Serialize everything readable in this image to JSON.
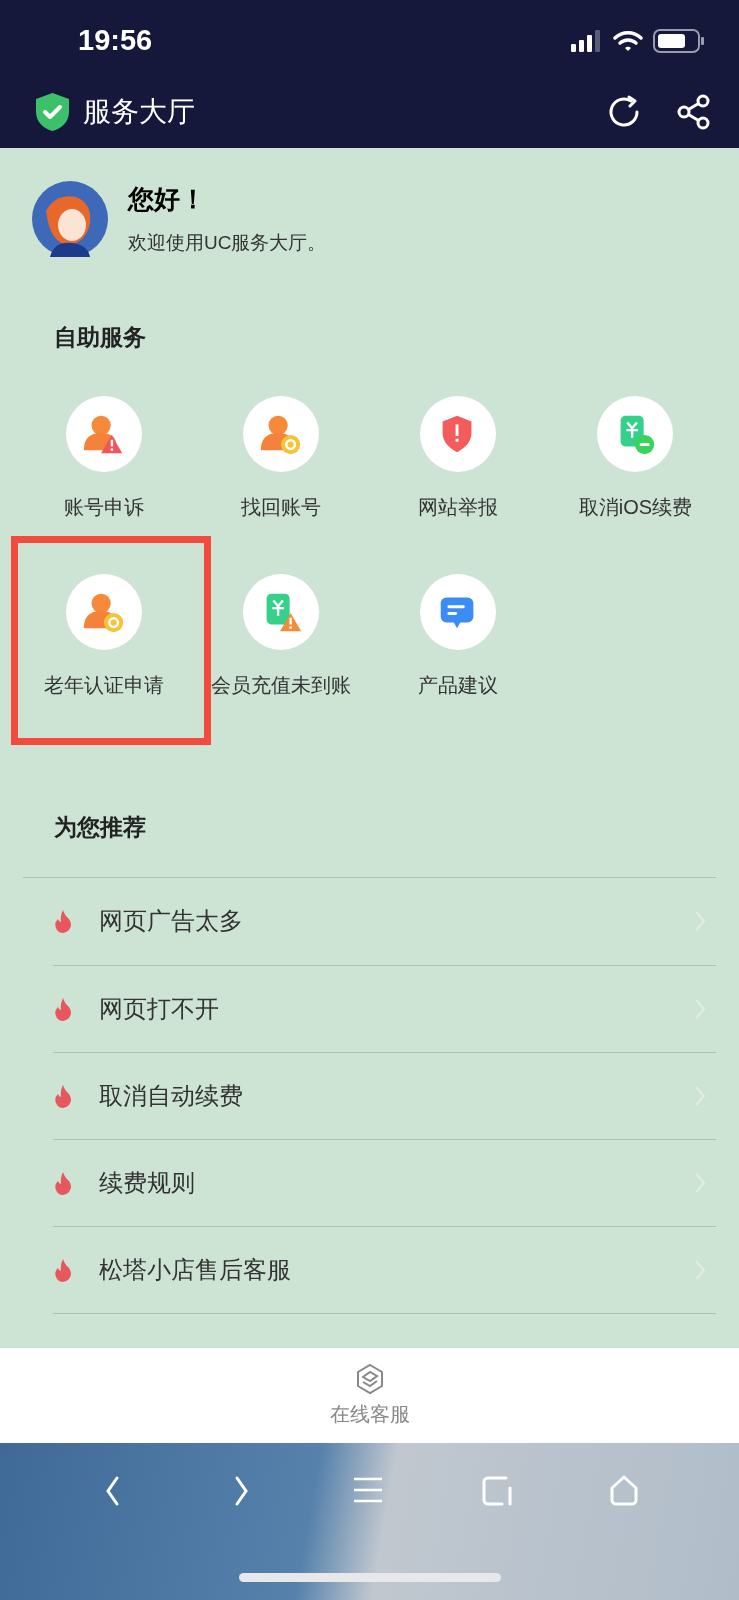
{
  "status_bar": {
    "time": "19:56"
  },
  "header": {
    "title": "服务大厅"
  },
  "greeting": {
    "title": "您好！",
    "subtitle": "欢迎使用UC服务大厅。"
  },
  "self_service": {
    "title": "自助服务",
    "items": [
      {
        "label": "账号申诉",
        "kind": "person-alert",
        "highlighted": false
      },
      {
        "label": "找回账号",
        "kind": "person-restore",
        "highlighted": false
      },
      {
        "label": "网站举报",
        "kind": "shield",
        "highlighted": false
      },
      {
        "label": "取消iOS续费",
        "kind": "bill-minus",
        "highlighted": false
      },
      {
        "label": "老年认证申请",
        "kind": "person-restore",
        "highlighted": true
      },
      {
        "label": "会员充值未到账",
        "kind": "bill-alert",
        "highlighted": false
      },
      {
        "label": "产品建议",
        "kind": "message",
        "highlighted": false
      }
    ]
  },
  "recommended": {
    "title": "为您推荐",
    "items": [
      {
        "label": "网页广告太多"
      },
      {
        "label": "网页打不开"
      },
      {
        "label": "取消自动续费"
      },
      {
        "label": "续费规则"
      },
      {
        "label": "松塔小店售后客服"
      }
    ]
  },
  "support_bar": {
    "label": "在线客服"
  }
}
